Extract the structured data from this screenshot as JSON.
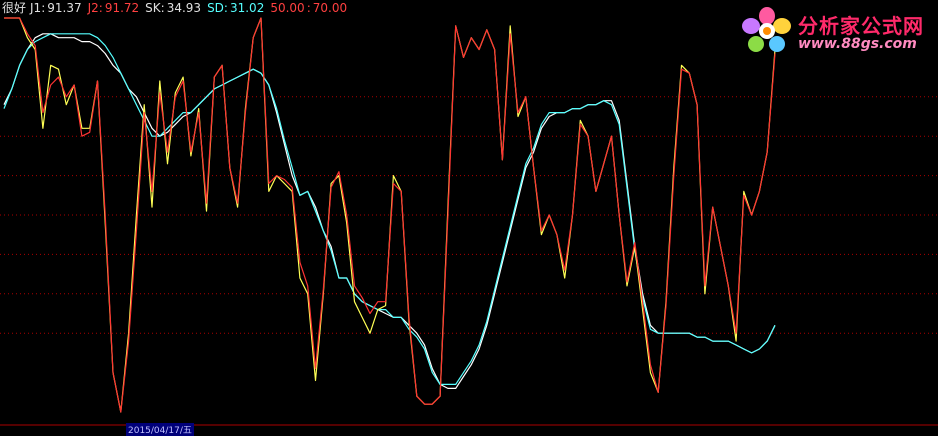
{
  "legend": {
    "title": "很好",
    "j1_label": "J1:",
    "j1_value": "91.37",
    "j2_label": "J2:",
    "j2_value": "91.72",
    "sk_label": "SK:",
    "sk_value": "34.93",
    "sd_label": "SD:",
    "sd_value": "31.02",
    "level_50": "50.00",
    "level_70": "70.00"
  },
  "logo": {
    "name": "分析家公式网",
    "url": "www.88gs.com"
  },
  "xaxis": {
    "date_label": "2015/04/17/五"
  },
  "colors": {
    "background": "#000000",
    "j1": "#ffff55",
    "j2": "#ff3333",
    "sk": "#ffffff",
    "sd": "#55ffff",
    "grid": "#aa0000",
    "legend_white": "#e0e0e0",
    "legend_red": "#ff4040",
    "legend_cyan": "#55ffff"
  },
  "chart_data": {
    "type": "line",
    "ylim": [
      0,
      100
    ],
    "grid_levels": [
      20,
      30,
      40,
      50,
      60,
      70,
      80
    ],
    "x": [
      0,
      1,
      2,
      3,
      4,
      5,
      6,
      7,
      8,
      9,
      10,
      11,
      12,
      13,
      14,
      15,
      16,
      17,
      18,
      19,
      20,
      21,
      22,
      23,
      24,
      25,
      26,
      27,
      28,
      29,
      30,
      31,
      32,
      33,
      34,
      35,
      36,
      37,
      38,
      39,
      40,
      41,
      42,
      43,
      44,
      45,
      46,
      47,
      48,
      49,
      50,
      51,
      52,
      53,
      54,
      55,
      56,
      57,
      58,
      59,
      60,
      61,
      62,
      63,
      64,
      65,
      66,
      67,
      68,
      69,
      70,
      71,
      72,
      73,
      74,
      75,
      76,
      77,
      78,
      79,
      80,
      81,
      82,
      83,
      84,
      85,
      86,
      87,
      88,
      89,
      90,
      91,
      92,
      93,
      94,
      95,
      96,
      97,
      98,
      99
    ],
    "series": [
      {
        "name": "J1",
        "values": [
          100,
          100,
          100,
          95,
          92,
          72,
          88,
          87,
          78,
          83,
          72,
          72,
          84,
          48,
          10,
          0,
          20,
          50,
          78,
          52,
          84,
          63,
          81,
          85,
          65,
          77,
          51,
          85,
          88,
          62,
          52,
          77,
          95,
          100,
          56,
          60,
          58,
          56,
          34,
          30,
          8,
          30,
          58,
          60,
          48,
          28,
          24,
          20,
          26,
          27,
          60,
          56,
          23,
          4,
          2,
          2,
          4,
          52,
          98,
          90,
          95,
          92,
          97,
          92,
          64,
          98,
          75,
          80,
          62,
          45,
          50,
          45,
          34,
          50,
          74,
          70,
          56,
          63,
          70,
          50,
          32,
          42,
          26,
          10,
          5,
          28,
          62,
          88,
          86,
          78,
          30,
          52,
          42,
          32,
          18,
          56,
          50,
          56,
          66,
          92
        ]
      },
      {
        "name": "J2",
        "values": [
          100,
          100,
          100,
          96,
          93,
          76,
          83,
          85,
          80,
          83,
          70,
          71,
          84,
          50,
          10,
          0,
          18,
          46,
          76,
          56,
          81,
          66,
          80,
          84,
          66,
          76,
          53,
          85,
          88,
          62,
          53,
          76,
          95,
          100,
          58,
          60,
          59,
          57,
          38,
          32,
          11,
          31,
          57,
          61,
          50,
          32,
          29,
          25,
          28,
          28,
          58,
          56,
          24,
          4,
          2,
          2,
          4,
          50,
          98,
          90,
          95,
          92,
          97,
          92,
          64,
          96,
          76,
          80,
          62,
          46,
          50,
          45,
          36,
          50,
          73,
          70,
          56,
          63,
          70,
          50,
          33,
          43,
          28,
          12,
          5,
          27,
          60,
          87,
          86,
          78,
          32,
          52,
          42,
          32,
          20,
          55,
          50,
          56,
          66,
          91
        ]
      },
      {
        "name": "SK",
        "values": [
          78,
          82,
          88,
          92,
          95,
          96,
          96,
          95,
          95,
          95,
          94,
          94,
          93,
          91,
          88,
          86,
          82,
          80,
          76,
          72,
          70,
          71,
          73,
          75,
          76,
          78,
          80,
          82,
          83,
          84,
          85,
          86,
          87,
          86,
          83,
          76,
          68,
          60,
          55,
          56,
          52,
          46,
          42,
          34,
          34,
          30,
          28,
          27,
          26,
          25,
          24,
          24,
          22,
          20,
          17,
          11,
          7,
          6,
          6,
          9,
          12,
          16,
          22,
          30,
          38,
          46,
          54,
          62,
          66,
          72,
          75,
          76,
          76,
          77,
          77,
          78,
          78,
          79,
          79,
          74,
          58,
          42,
          30,
          22,
          20,
          20,
          20,
          20,
          20,
          19,
          19,
          18,
          18,
          18,
          17,
          16,
          15,
          16,
          18,
          22
        ]
      },
      {
        "name": "SD",
        "values": [
          77,
          82,
          88,
          92,
          94,
          95,
          96,
          96,
          96,
          96,
          96,
          96,
          95,
          93,
          90,
          86,
          82,
          78,
          74,
          70,
          70,
          72,
          74,
          76,
          76,
          78,
          80,
          82,
          83,
          84,
          85,
          86,
          87,
          86,
          83,
          77,
          69,
          62,
          55,
          56,
          51,
          46,
          41,
          34,
          34,
          30,
          28,
          27,
          26,
          26,
          24,
          24,
          21,
          19,
          16,
          10,
          7,
          7,
          7,
          10,
          13,
          17,
          23,
          31,
          39,
          47,
          55,
          63,
          67,
          73,
          76,
          76,
          76,
          77,
          77,
          78,
          78,
          79,
          78,
          73,
          57,
          41,
          29,
          21,
          20,
          20,
          20,
          20,
          20,
          19,
          19,
          18,
          18,
          18,
          17,
          16,
          15,
          16,
          18,
          22
        ]
      }
    ]
  }
}
